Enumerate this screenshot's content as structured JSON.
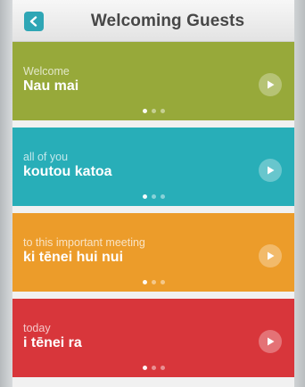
{
  "nav": {
    "title": "Welcoming Guests",
    "back_icon": "chevron-left-icon"
  },
  "phrases": [
    {
      "english": "Welcome",
      "maori": "Nau mai",
      "color": "#97a93a",
      "play_icon": "play-icon",
      "pages": 3,
      "active_page": 1
    },
    {
      "english": "all of you",
      "maori": "koutou katoa",
      "color": "#28aeb8",
      "play_icon": "play-icon",
      "pages": 3,
      "active_page": 1
    },
    {
      "english": "to this important meeting",
      "maori": "ki tēnei hui nui",
      "color": "#ec9c2a",
      "play_icon": "play-icon",
      "pages": 3,
      "active_page": 1
    },
    {
      "english": "today",
      "maori": "i tēnei ra",
      "color": "#d8363b",
      "play_icon": "play-icon",
      "pages": 3,
      "active_page": 1
    }
  ],
  "colors": {
    "accent": "#2fa6b5"
  }
}
